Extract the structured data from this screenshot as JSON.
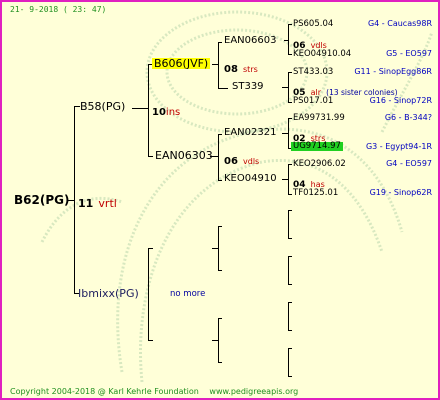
{
  "header": {
    "date": "21-  9-2018 (  23: 47)"
  },
  "footer": {
    "copyright": "Copyright 2004-2018 @ Karl Kehrle Foundation",
    "url": "www.pedigreeapis.org"
  },
  "root": {
    "name": "B62(PG)",
    "number": "11",
    "property": "vrtl"
  },
  "gen1": {
    "sire": {
      "name": "B58(PG)",
      "number": "10",
      "property": "ins"
    },
    "dam": {
      "name": "Ibmixx(PG)",
      "note": "no more"
    }
  },
  "gen2": {
    "ss": {
      "name": "B606(JVF)",
      "number": "08",
      "property": "strs"
    },
    "sd": {
      "name": "EAN06303",
      "number": "06",
      "property": "vdls"
    }
  },
  "gen3": {
    "sss": {
      "name": "EAN06603",
      "number": "06",
      "property": "vdls"
    },
    "ssd": {
      "name": "ST339",
      "number": "05",
      "property": "alr",
      "note": "(13 sister colonies)"
    },
    "sds": {
      "name": "EAN02321",
      "number": "02",
      "property": "strs"
    },
    "sdd": {
      "name": "KEO04910",
      "number": "04",
      "property": "has"
    }
  },
  "gen4": [
    {
      "name": "PS605.04",
      "loc": "G4 - Caucas98R"
    },
    {
      "name": "KEO04910.04",
      "loc": "G5 - EO597"
    },
    {
      "name": "ST433.03",
      "loc": "G11 - SinopEgg86R"
    },
    {
      "name": "PS017.01",
      "loc": "G16 - Sinop72R"
    },
    {
      "name": "EA99731.99",
      "loc": "G6 - B-344?"
    },
    {
      "name": "UG9714.97",
      "loc": "G3 - Egypt94-1R"
    },
    {
      "name": "KEO2906.02",
      "loc": "G4 - EO597"
    },
    {
      "name": "TF0125.01",
      "loc": "G19 - Sinop62R"
    }
  ]
}
